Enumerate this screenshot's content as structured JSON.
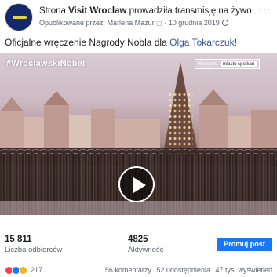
{
  "header": {
    "prefix": "Strona",
    "page_name": "Visit Wroclaw",
    "action": "prowadziła transmisję na żywo.",
    "published_by_label": "Opublikowane przez:",
    "author": "Marlena Mazur",
    "date": "10 grudnia 2019",
    "more_glyph": "···"
  },
  "post": {
    "text_before": "Oficjalne wręczenie Nagrody Nobla dla",
    "mention": "Olga Tokarczuk",
    "text_after": "!"
  },
  "video": {
    "hashtag": "#WroclawskiNobel",
    "logo_left": "Wrocław",
    "logo_right": "miasto spotkań"
  },
  "stats": {
    "reach_value": "15 811",
    "reach_label": "Liczba odbiorców",
    "engagement_value": "4825",
    "engagement_label": "Aktywność",
    "promote_label": "Promuj post"
  },
  "footer": {
    "reactions_count": "217",
    "comments": "56 komentarzy",
    "shares": "52 udostępnienia",
    "views": "47 tys. wyświetleń"
  },
  "colors": {
    "link": "#385898",
    "promote_button": "#1877f2"
  },
  "icons": [
    "avatar",
    "globe-icon",
    "more-icon",
    "play-icon",
    "love-reaction-icon",
    "like-reaction-icon",
    "wow-reaction-icon"
  ]
}
